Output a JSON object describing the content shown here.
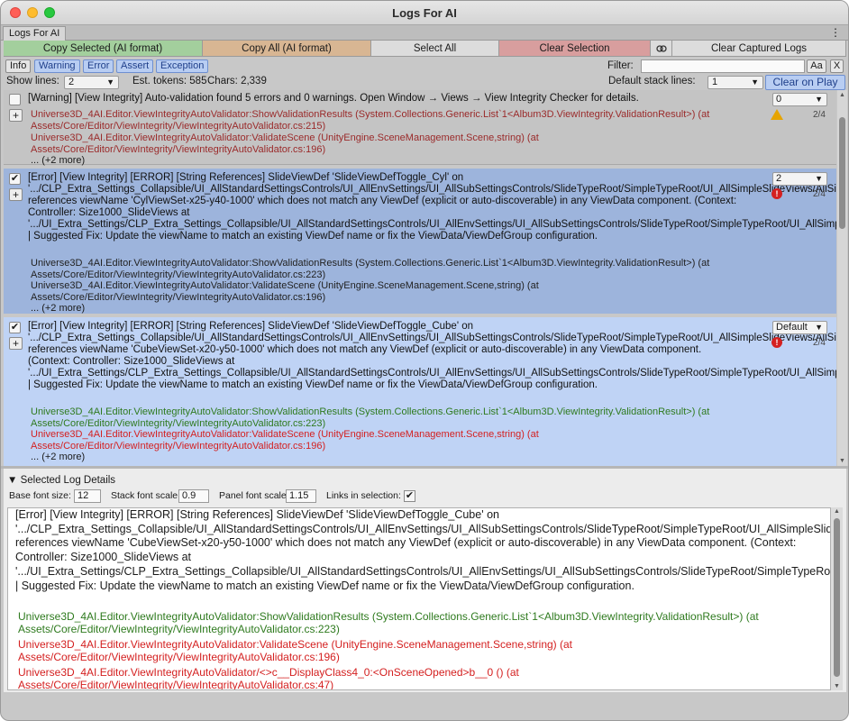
{
  "window": {
    "title": "Logs For AI",
    "tab": "Logs For AI",
    "tab_menu": "⋮"
  },
  "actions": {
    "copy_selected": "Copy Selected (AI format)",
    "copy_all": "Copy All (AI format)",
    "select_all": "Select All",
    "clear_selection": "Clear Selection",
    "link_icon": "⊖",
    "clear_captured": "Clear Captured Logs",
    "colors": {
      "copy_selected": "#a3cf9d",
      "copy_all": "#d8b693",
      "select_all": "#dcdcdc",
      "clear_selection": "#d89e9e",
      "link": "#dcdcdc",
      "clear_captured": "#dcdcdc"
    }
  },
  "filters": {
    "info": "Info",
    "warning": "Warning",
    "error": "Error",
    "assert": "Assert",
    "exception": "Exception",
    "filter_label": "Filter:",
    "filter_value": "",
    "case_btn": "Aa",
    "clear_btn": "X"
  },
  "show": {
    "show_lines_label": "Show lines:",
    "show_lines_value": "2",
    "est_tokens": "Est. tokens: 585",
    "chars": "Chars: 2,339",
    "default_stack_label": "Default stack lines:",
    "default_stack_value": "1",
    "clear_on_play": "Clear on Play"
  },
  "entries": [
    {
      "checked": "",
      "message": "[Warning] [View Integrity] Auto-validation found 5 errors and 0 warnings. Open Window → Views → View Integrity Checker for details.",
      "stack1": "Universe3D_4AI.Editor.ViewIntegrityAutoValidator:ShowValidationResults (System.Collections.Generic.List`1<Album3D.ViewIntegrity.ValidationResult>) (at Assets/Core/Editor/ViewIntegrity/ViewIntegrityAutoValidator.cs:215)",
      "stack2": "Universe3D_4AI.Editor.ViewIntegrityAutoValidator:ValidateScene (UnityEngine.SceneManagement.Scene,string) (at Assets/Core/Editor/ViewIntegrity/ViewIntegrityAutoValidator.cs:196)",
      "more": "... (+2 more)",
      "dropdown": "0",
      "count": "2/4"
    },
    {
      "checked": "✔",
      "message": "[Error] [View Integrity] [ERROR] [String References] SlideViewDef 'SlideViewDefToggle_Cyl' on '.../CLP_Extra_Settings_Collapsible/UI_AllStandardSettingsControls/UI_AllEnvSettings/UI_AllSubSettingsControls/SlideTypeRoot/SimpleTypeRoot/UI_AllSimpleSlideViews/AllSimpleSlideViews/Size1000_SlideViews/SlideViewDefToggle_Cyl' references viewName 'CylViewSet-x25-y40-1000' which does not match any ViewDef (explicit or auto-discoverable) in any ViewData component. (Context: Controller: Size1000_SlideViews at '.../UI_Extra_Settings/CLP_Extra_Settings_Collapsible/UI_AllStandardSettingsControls/UI_AllEnvSettings/UI_AllSubSettingsControls/SlideTypeRoot/SimpleTypeRoot/UI_AllSimpleSlideViews/AllSimpleSlideViews/Size1000_SlideViews') | Suggested Fix: Update the viewName to match an existing ViewDef name or fix the ViewData/ViewDefGroup configuration.",
      "stack1": "Universe3D_4AI.Editor.ViewIntegrityAutoValidator:ShowValidationResults (System.Collections.Generic.List`1<Album3D.ViewIntegrity.ValidationResult>) (at Assets/Core/Editor/ViewIntegrity/ViewIntegrityAutoValidator.cs:223)",
      "stack2": "Universe3D_4AI.Editor.ViewIntegrityAutoValidator:ValidateScene (UnityEngine.SceneManagement.Scene,string) (at Assets/Core/Editor/ViewIntegrity/ViewIntegrityAutoValidator.cs:196)",
      "more": "... (+2 more)",
      "dropdown": "2",
      "count": "2/4"
    },
    {
      "checked": "✔",
      "message": "[Error] [View Integrity] [ERROR] [String References] SlideViewDef 'SlideViewDefToggle_Cube' on '.../CLP_Extra_Settings_Collapsible/UI_AllStandardSettingsControls/UI_AllEnvSettings/UI_AllSubSettingsControls/SlideTypeRoot/SimpleTypeRoot/UI_AllSimpleSlideViews/AllSimpleSlideViews/Size1000_SlideViews/SlideViewDefToggle_Cube' references viewName 'CubeViewSet-x20-y50-1000' which does not match any ViewDef (explicit or auto-discoverable) in any ViewData component. (Context: Controller: Size1000_SlideViews at '.../UI_Extra_Settings/CLP_Extra_Settings_Collapsible/UI_AllStandardSettingsControls/UI_AllEnvSettings/UI_AllSubSettingsControls/SlideTypeRoot/SimpleTypeRoot/UI_AllSimpleSlideViews/AllSimpleSlideViews/Size1000_SlideViews') | Suggested Fix: Update the viewName to match an existing ViewDef name or fix the ViewData/ViewDefGroup configuration.",
      "stack1": "Universe3D_4AI.Editor.ViewIntegrityAutoValidator:ShowValidationResults (System.Collections.Generic.List`1<Album3D.ViewIntegrity.ValidationResult>) (at Assets/Core/Editor/ViewIntegrity/ViewIntegrityAutoValidator.cs:223)",
      "stack2": "Universe3D_4AI.Editor.ViewIntegrityAutoValidator:ValidateScene (UnityEngine.SceneManagement.Scene,string) (at Assets/Core/Editor/ViewIntegrity/ViewIntegrityAutoValidator.cs:196)",
      "more": "... (+2 more)",
      "dropdown": "Default",
      "count": "2/4"
    }
  ],
  "details": {
    "header": "▼ Selected Log Details",
    "base_font_label": "Base font size:",
    "base_font_value": "12",
    "stack_scale_label": "Stack font scale",
    "stack_scale_value": "0.9",
    "panel_scale_label": "Panel font scale:",
    "panel_scale_value": "1.15",
    "links_label": "Links in selection:",
    "links_checked": "✔",
    "message": "[Error] [View Integrity] [ERROR] [String References] SlideViewDef 'SlideViewDefToggle_Cube' on '.../CLP_Extra_Settings_Collapsible/UI_AllStandardSettingsControls/UI_AllEnvSettings/UI_AllSubSettingsControls/SlideTypeRoot/SimpleTypeRoot/UI_AllSimpleSlideViews/AllSimpleSlideViews/Size1000_SlideViews/SlideViewDefToggle_Cube' references viewName 'CubeViewSet-x20-y50-1000' which does not match any ViewDef (explicit or auto-discoverable) in any ViewData component. (Context: Controller: Size1000_SlideViews at '.../UI_Extra_Settings/CLP_Extra_Settings_Collapsible/UI_AllStandardSettingsControls/UI_AllEnvSettings/UI_AllSubSettingsControls/SlideTypeRoot/SimpleTypeRoot/UI_AllSimpleSlideViews/AllSimpleSlideViews/Size1000_SlideViews') | Suggested Fix: Update the viewName to match an existing ViewDef name or fix the ViewData/ViewDefGroup configuration.",
    "stack1": "Universe3D_4AI.Editor.ViewIntegrityAutoValidator:ShowValidationResults (System.Collections.Generic.List`1<Album3D.ViewIntegrity.ValidationResult>) (at Assets/Core/Editor/ViewIntegrity/ViewIntegrityAutoValidator.cs:223)",
    "stack2": "Universe3D_4AI.Editor.ViewIntegrityAutoValidator:ValidateScene (UnityEngine.SceneManagement.Scene,string) (at Assets/Core/Editor/ViewIntegrity/ViewIntegrityAutoValidator.cs:196)",
    "stack3": "Universe3D_4AI.Editor.ViewIntegrityAutoValidator/<>c__DisplayClass4_0:<OnSceneOpened>b__0 () (at Assets/Core/Editor/ViewIntegrity/ViewIntegrityAutoValidator.cs:47)"
  }
}
